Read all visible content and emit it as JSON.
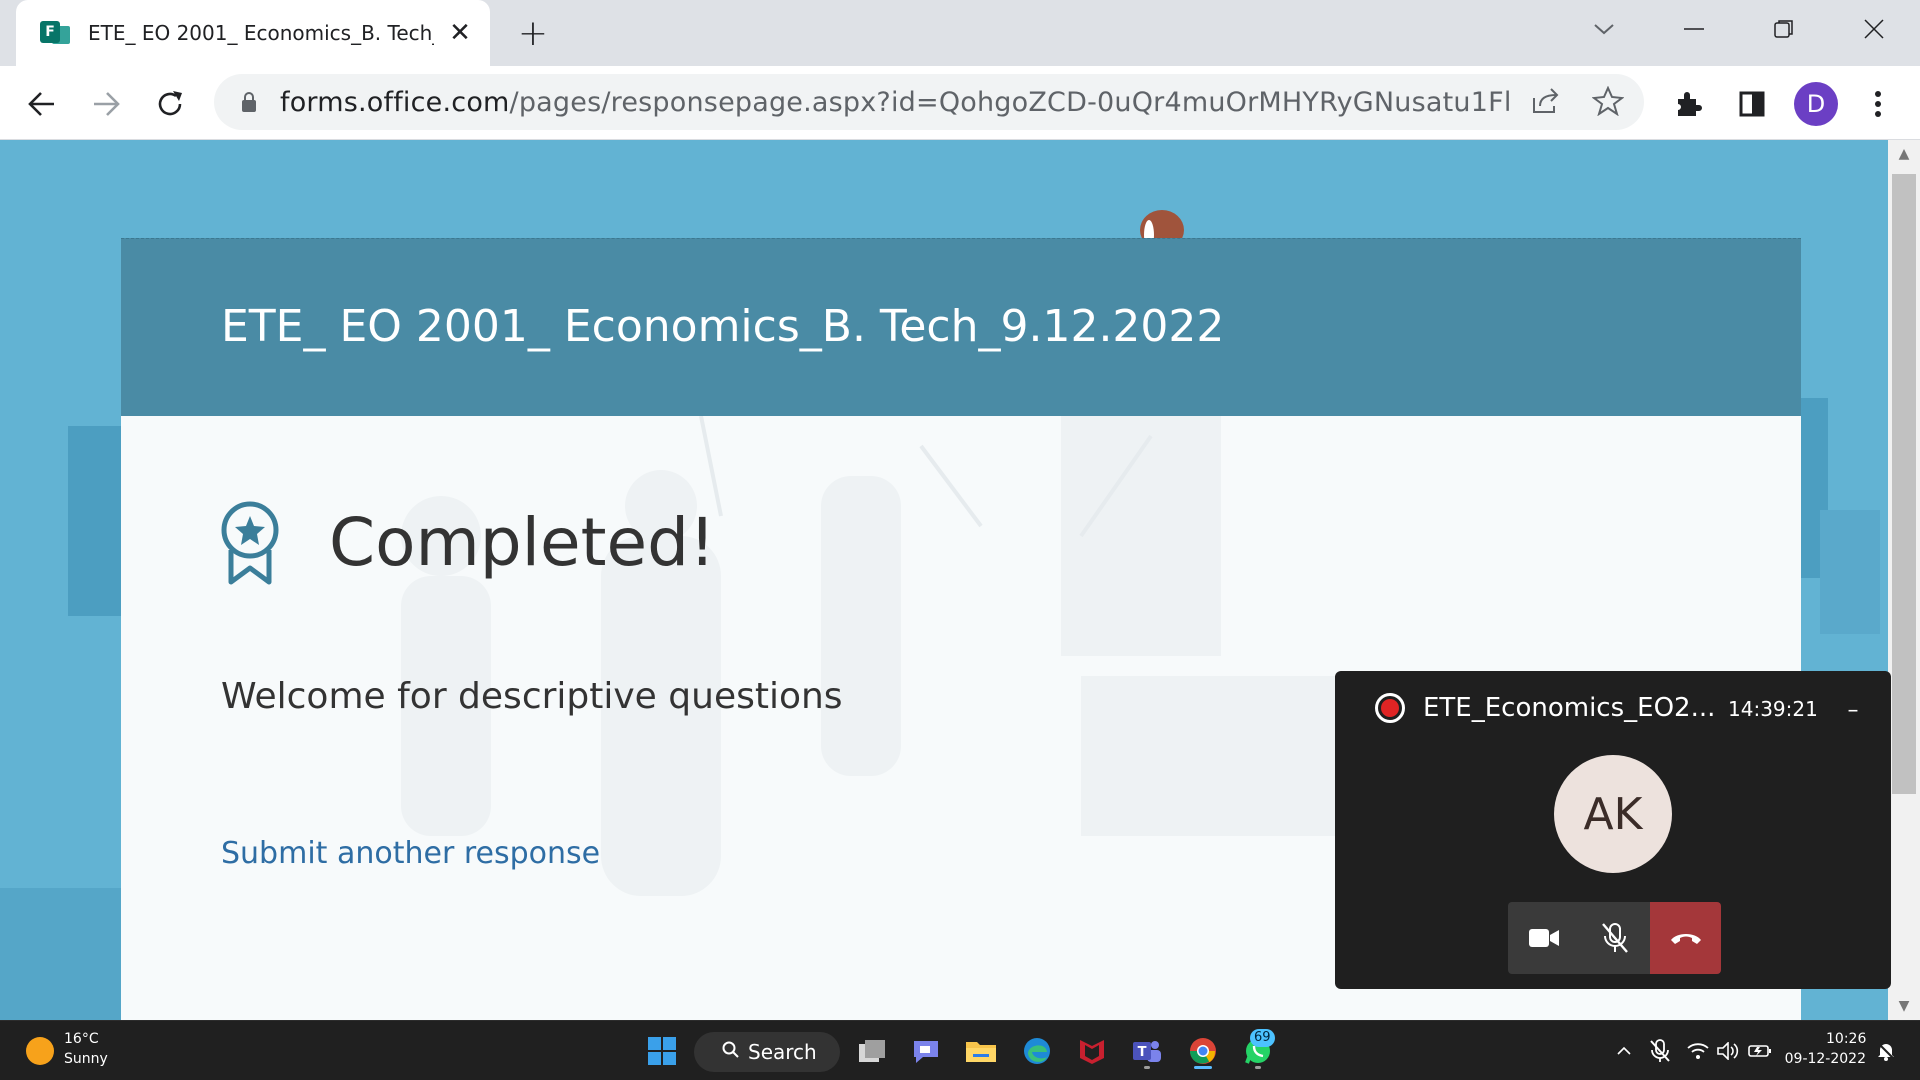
{
  "browser": {
    "tab": {
      "title": "ETE_ EO 2001_ Economics_B. Tech_9.12.2022",
      "favicon": "forms-icon"
    },
    "url_host": "forms.office.com",
    "url_path": "/pages/responsepage.aspx?id=QohgoZCD-0uQr4muOrMHYRyGNusatu1Fl55CBGi...",
    "profile_initial": "D"
  },
  "form": {
    "title": "ETE_ EO 2001_ Economics_B. Tech_9.12.2022",
    "status": "Completed!",
    "message": "Welcome for descriptive questions",
    "submit_another": "Submit another response"
  },
  "meeting": {
    "title": "ETE_Economics_EO2...",
    "time": "14:39:21",
    "participant_initials": "AK"
  },
  "taskbar": {
    "weather_temp": "16°C",
    "weather_desc": "Sunny",
    "search_label": "Search",
    "whatsapp_badge": "69",
    "clock_time": "10:26",
    "clock_date": "09-12-2022"
  },
  "colors": {
    "page_bg": "#62b3d3",
    "header_bg": "#4a8ba5",
    "link": "#2e6da4",
    "hangup": "#a4373a"
  }
}
